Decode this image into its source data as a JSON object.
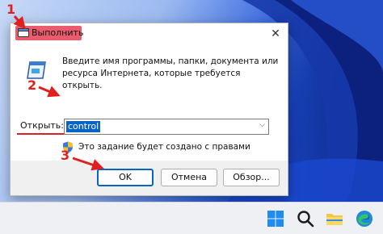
{
  "dialog": {
    "title": "Выполнить",
    "description": "Введите имя программы, папки, документа или ресурса Интернета, которые требуется открыть.",
    "open_label": "Открыть:",
    "open_value": "control",
    "admin_note": "Это задание будет создано с правами",
    "close_glyph": "✕",
    "dropdown_glyph": "⌵"
  },
  "buttons": {
    "ok": "OK",
    "cancel": "Отмена",
    "browse": "Обзор..."
  },
  "annotations": {
    "step1": "1",
    "step2": "2",
    "step3": "3",
    "color": "#e02020"
  },
  "taskbar": {
    "icons": [
      "windows-start-icon",
      "search-icon",
      "file-explorer-icon",
      "edge-browser-icon"
    ]
  }
}
